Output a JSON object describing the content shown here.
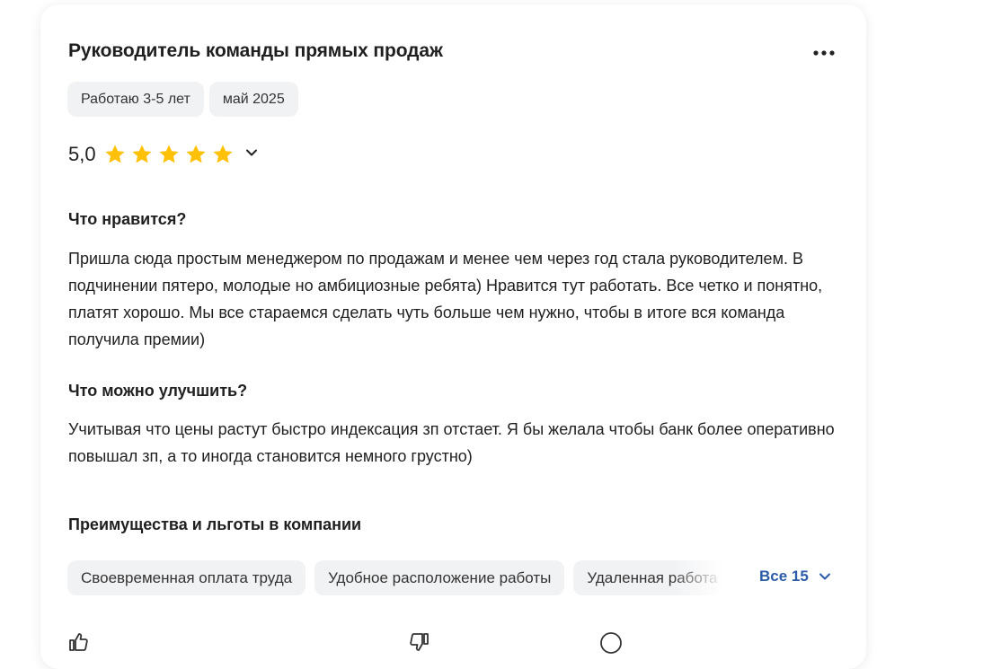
{
  "review": {
    "title": "Руководитель команды прямых продаж",
    "tags": [
      "Работаю 3-5 лет",
      "май 2025"
    ],
    "rating": {
      "value": "5,0",
      "stars_filled": 5,
      "stars_total": 5,
      "star_color": "#ffc107"
    },
    "likes": {
      "heading": "Что нравится?",
      "text": "Пришла сюда простым менеджером по продажам и менее чем через год стала руководителем. В подчинении пятеро, молодые но амбициозные ребята) Нравится тут работать. Все четко и понятно, платят хорошо. Мы все стараемся сделать чуть больше чем нужно, чтобы в итоге вся команда получила премии)"
    },
    "improve": {
      "heading": "Что можно улучшить?",
      "text": "Учитывая что цены растут быстро индексация зп отстает. Я бы желала чтобы банк более оперативно повышал зп, а то иногда становится немного грустно)"
    },
    "benefits": {
      "heading": "Преимущества и льготы в компании",
      "items": [
        "Своевременная оплата труда",
        "Удобное расположение работы",
        "Удаленная работа"
      ],
      "all_label": "Все 15"
    }
  },
  "colors": {
    "link": "#2c5ba8",
    "chip_bg": "#f1f2f4",
    "star": "#ffc107"
  },
  "icons": [
    "more-dots-icon",
    "star-icon",
    "chevron-down-icon",
    "thumb-up-icon",
    "thumb-down-icon",
    "comment-icon"
  ]
}
